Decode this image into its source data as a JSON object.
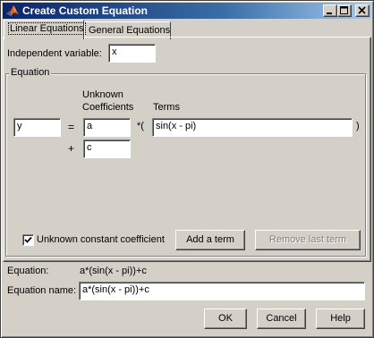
{
  "window": {
    "title": "Create Custom Equation",
    "controls": {
      "minimize": "_",
      "maximize": "□",
      "close": "✕"
    }
  },
  "tabs": [
    {
      "label": "Linear Equations",
      "active": true
    },
    {
      "label": "General Equations",
      "active": false
    }
  ],
  "independent_variable": {
    "label": "Independent variable:",
    "value": "x"
  },
  "equation_group": {
    "title": "Equation",
    "unknown_coefficients_label_line1": "Unknown",
    "unknown_coefficients_label_line2": "Coefficients",
    "terms_label": "Terms",
    "lhs_value": "y",
    "equals_sign": "=",
    "plus_sign": "+",
    "times_open": "*(",
    "close_paren": ")",
    "coefficient_1": "a",
    "term_1": "sin(x - pi)",
    "coefficient_2": "c",
    "constant_checkbox": {
      "label": "Unknown constant coefficient",
      "checked": true
    },
    "add_term_button": "Add a term",
    "remove_last_term_button": "Remove last term"
  },
  "equation_summary": {
    "label": "Equation:",
    "value": "a*(sin(x - pi))+c"
  },
  "equation_name": {
    "label": "Equation name:",
    "value": "a*(sin(x - pi))+c"
  },
  "footer": {
    "ok": "OK",
    "cancel": "Cancel",
    "help": "Help"
  }
}
